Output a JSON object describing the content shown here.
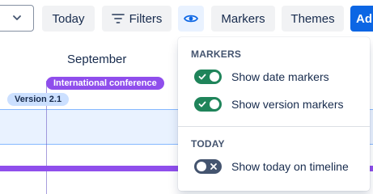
{
  "toolbar": {
    "today_label": "Today",
    "filters_label": "Filters",
    "markers_label": "Markers",
    "themes_label": "Themes",
    "add_label": "Ad",
    "icons": {
      "select": "chevron-down-icon",
      "filters": "filter-icon",
      "visibility": "eye-icon"
    }
  },
  "timeline": {
    "month": "September",
    "date_marker": "International conference",
    "version_marker": "Version 2.1"
  },
  "markers_menu": {
    "markers_heading": "MARKERS",
    "options": [
      {
        "label": "Show date markers",
        "checked": true
      },
      {
        "label": "Show version markers",
        "checked": true
      }
    ],
    "today_heading": "TODAY",
    "today_option": {
      "label": "Show today on timeline",
      "checked": false
    }
  },
  "colors": {
    "accent": "#0c66e4",
    "toggle_on": "#1f845a",
    "toggle_off": "#44546f",
    "conference_pill": "#8f4eec",
    "version_pill": "#cce0ff",
    "selected_button": "#e9f2ff"
  }
}
